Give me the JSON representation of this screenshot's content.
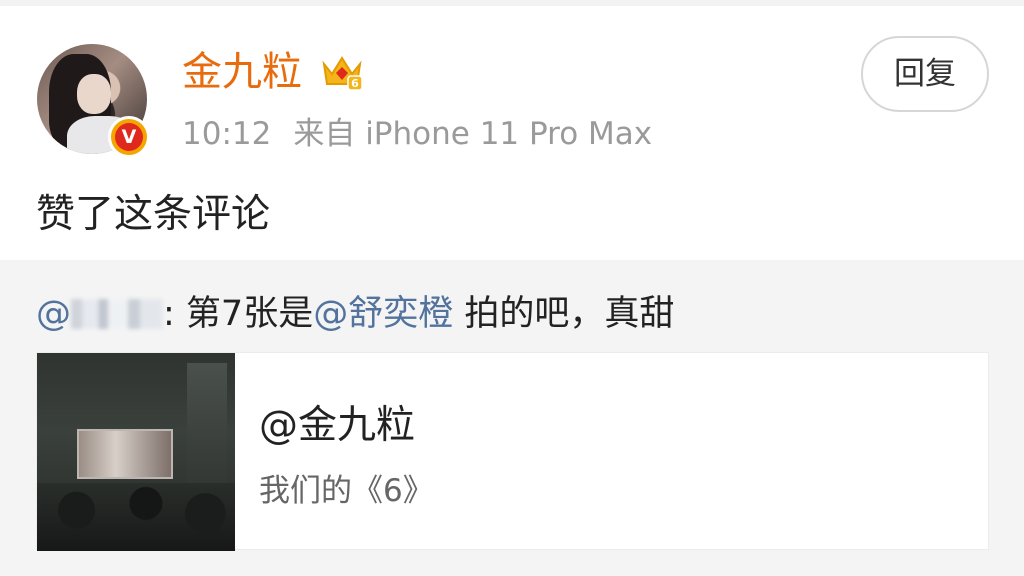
{
  "comment": {
    "user": {
      "name": "金九粒",
      "level_badge": "6",
      "verified_mark": "V"
    },
    "time": "10:12",
    "source": "来自 iPhone 11 Pro Max",
    "reply_label": "回复",
    "text": "赞了这条评论"
  },
  "quoted": {
    "prefix": "@",
    "separator": ": ",
    "part1": "第7张是",
    "mention": "@舒奕橙",
    "part2": " 拍的吧，真甜"
  },
  "card": {
    "title": "@金九粒",
    "subtitle": "我们的《6》"
  },
  "colors": {
    "username": "#e86b0d",
    "mention": "#52739d",
    "meta": "#9a9a9a",
    "repost_bg": "#f4f4f4"
  }
}
